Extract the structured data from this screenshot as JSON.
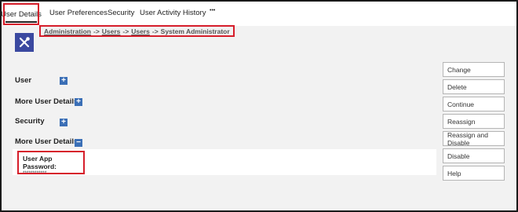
{
  "tabs": {
    "user_details": "User Details",
    "user_preferences": "User Preferences",
    "security": "Security",
    "user_activity_history": "User Activity History",
    "more": "•••"
  },
  "logo_icon": "tools-icon",
  "breadcrumb": {
    "administration": "Administration",
    "sep1": "->",
    "users1": "Users",
    "sep2": "->",
    "users2": "Users",
    "sep3": "->",
    "current": "System Administrator"
  },
  "sections": {
    "user": "User",
    "more_user_details_1": "More User Details",
    "security": "Security",
    "more_user_details_2": "More User Details"
  },
  "expanded": {
    "password_label": "User App Password:",
    "password_value": "************"
  },
  "expander_symbols": {
    "plus": "+",
    "minus": "−"
  },
  "actions": [
    "Change",
    "Delete",
    "Continue",
    "Reassign",
    "Reassign and Disable",
    "Disable",
    "Help"
  ],
  "colors": {
    "highlight": "#d61e2b",
    "logo": "#3b49a0",
    "expander": "#3b6fb6"
  }
}
